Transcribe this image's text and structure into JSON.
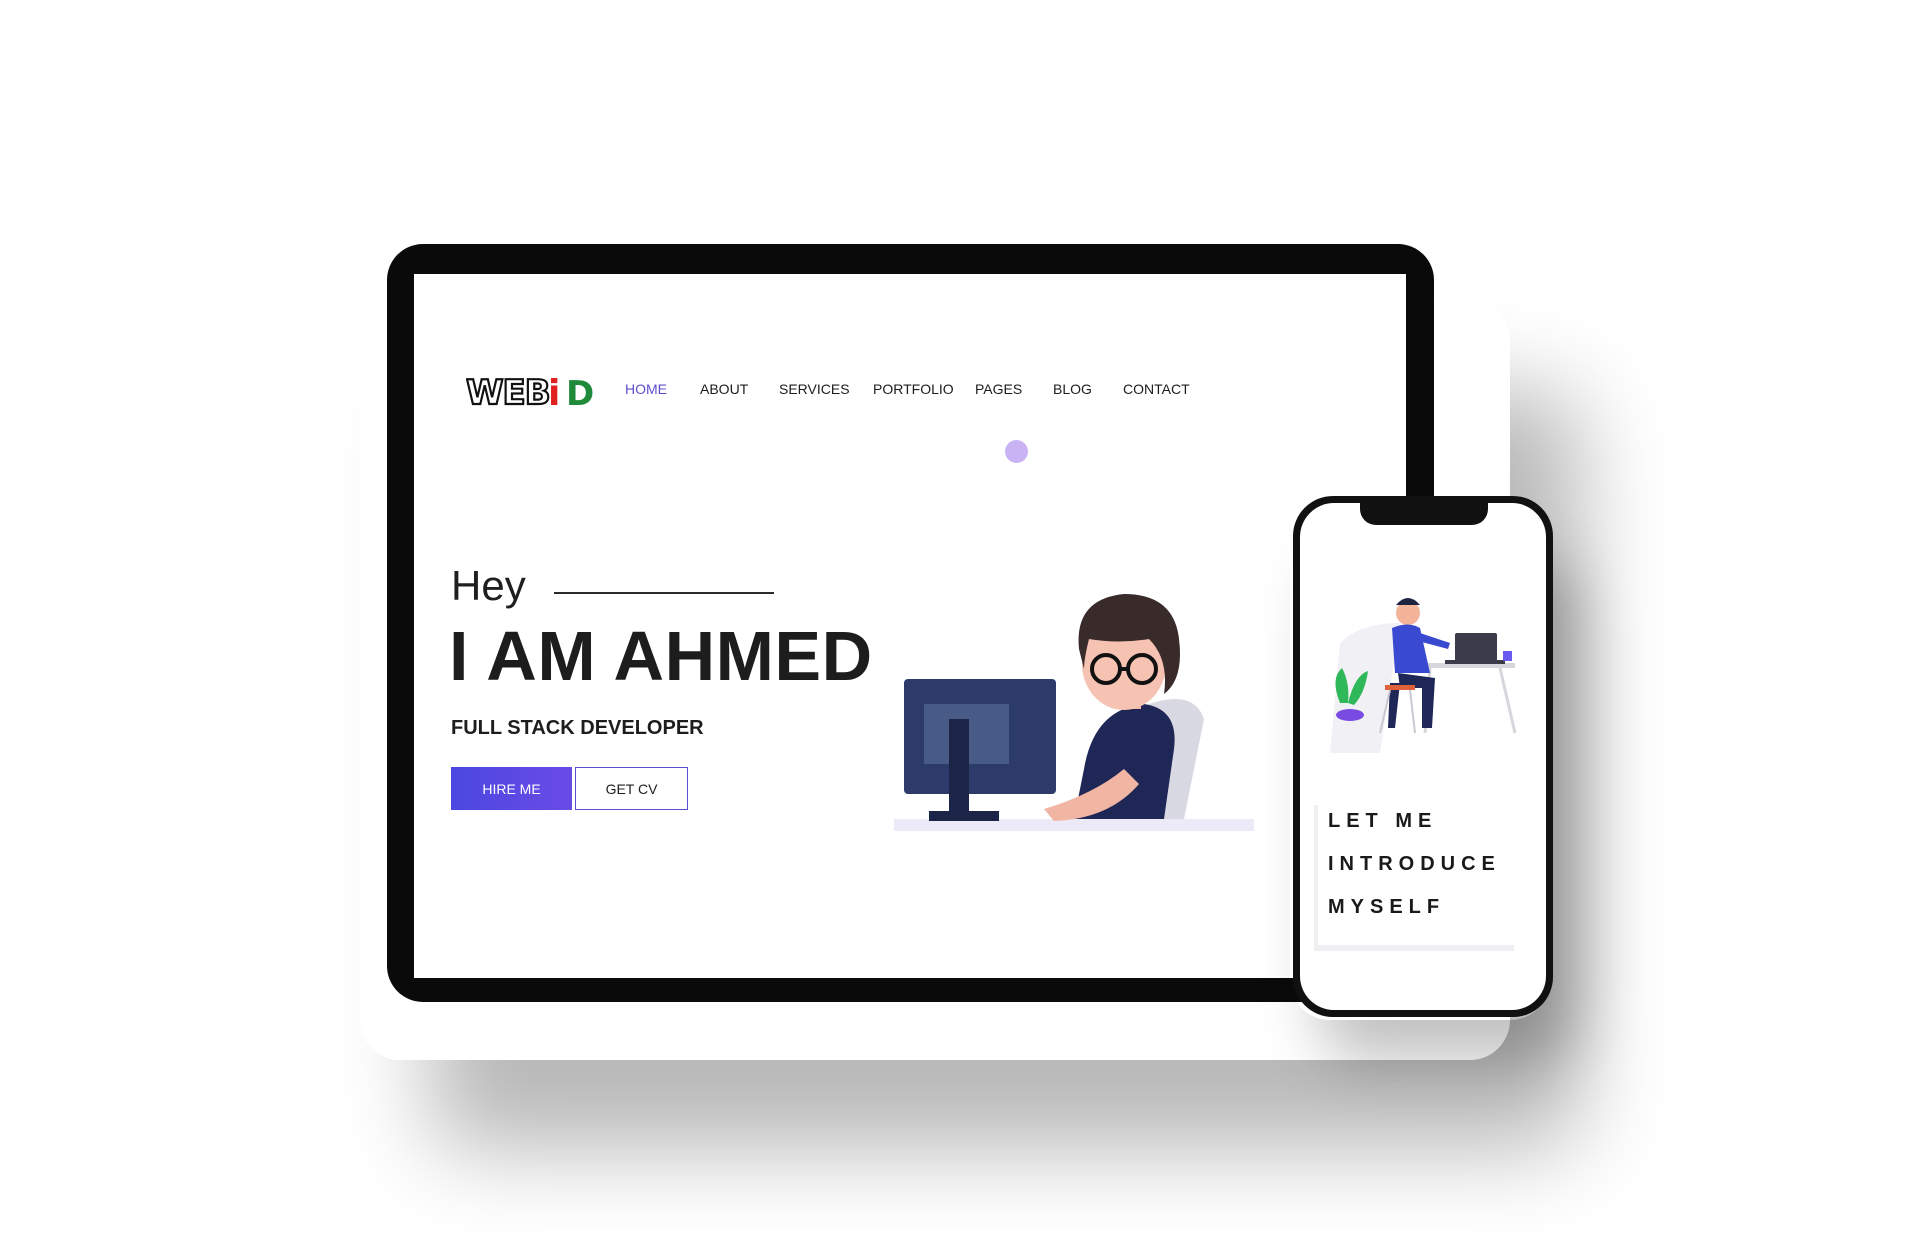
{
  "logo": {
    "text_main": "WEB",
    "text_accent": "iD",
    "colors": {
      "main": "#111111",
      "i": "#e02020",
      "d": "#1e8a3a"
    }
  },
  "nav": {
    "items": [
      "HOME",
      "ABOUT",
      "SERVICES",
      "PORTFOLIO",
      "PAGES",
      "BLOG",
      "CONTACT"
    ],
    "active": "HOME",
    "active_color": "#5a4fcf"
  },
  "hero": {
    "greeting": "Hey",
    "name": "I AM AHMED",
    "role": "FULL STACK DEVELOPER",
    "hire_button": "HIRE ME",
    "cv_button": "GET CV",
    "illustration": "developer-at-computer-illustration"
  },
  "mobile": {
    "illustration": "person-at-desk-illustration",
    "intro_lines": [
      "LET ME",
      "INTRODUCE",
      "MYSELF"
    ]
  },
  "colors": {
    "accent": "#5a4fcf",
    "dot": "#c9b3f5",
    "device_frame": "#0a0a0a"
  }
}
